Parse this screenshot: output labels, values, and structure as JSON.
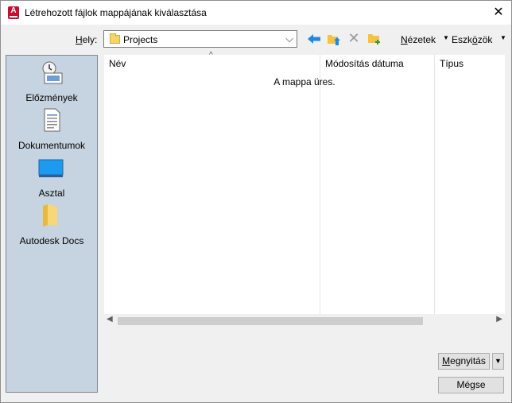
{
  "window": {
    "title": "Létrehozott fájlok mappájának kiválasztása"
  },
  "toolbar": {
    "location_label_u": "H",
    "location_label_rest": "ely:",
    "location_value": "Projects",
    "views_u": "N",
    "views_rest": "ézetek",
    "tools_pre": "Eszk",
    "tools_u": "ö",
    "tools_rest": "zök"
  },
  "places": [
    {
      "label": "Előzmények",
      "icon": "history-icon"
    },
    {
      "label": "Dokumentumok",
      "icon": "documents-icon"
    },
    {
      "label": "Asztal",
      "icon": "desktop-icon"
    },
    {
      "label": "Autodesk Docs",
      "icon": "folder-icon"
    }
  ],
  "file_list": {
    "columns": [
      "Név",
      "Módosítás dátuma",
      "Típus"
    ],
    "empty_message": "A mappa üres."
  },
  "buttons": {
    "open_u": "M",
    "open_rest": "egnyitás",
    "cancel": "Mégse"
  },
  "colors": {
    "places_bg": "#c6d3e0",
    "accent_arrow": "#1e88e5",
    "folder": "#f5c242",
    "app_icon": "#c8102e"
  }
}
